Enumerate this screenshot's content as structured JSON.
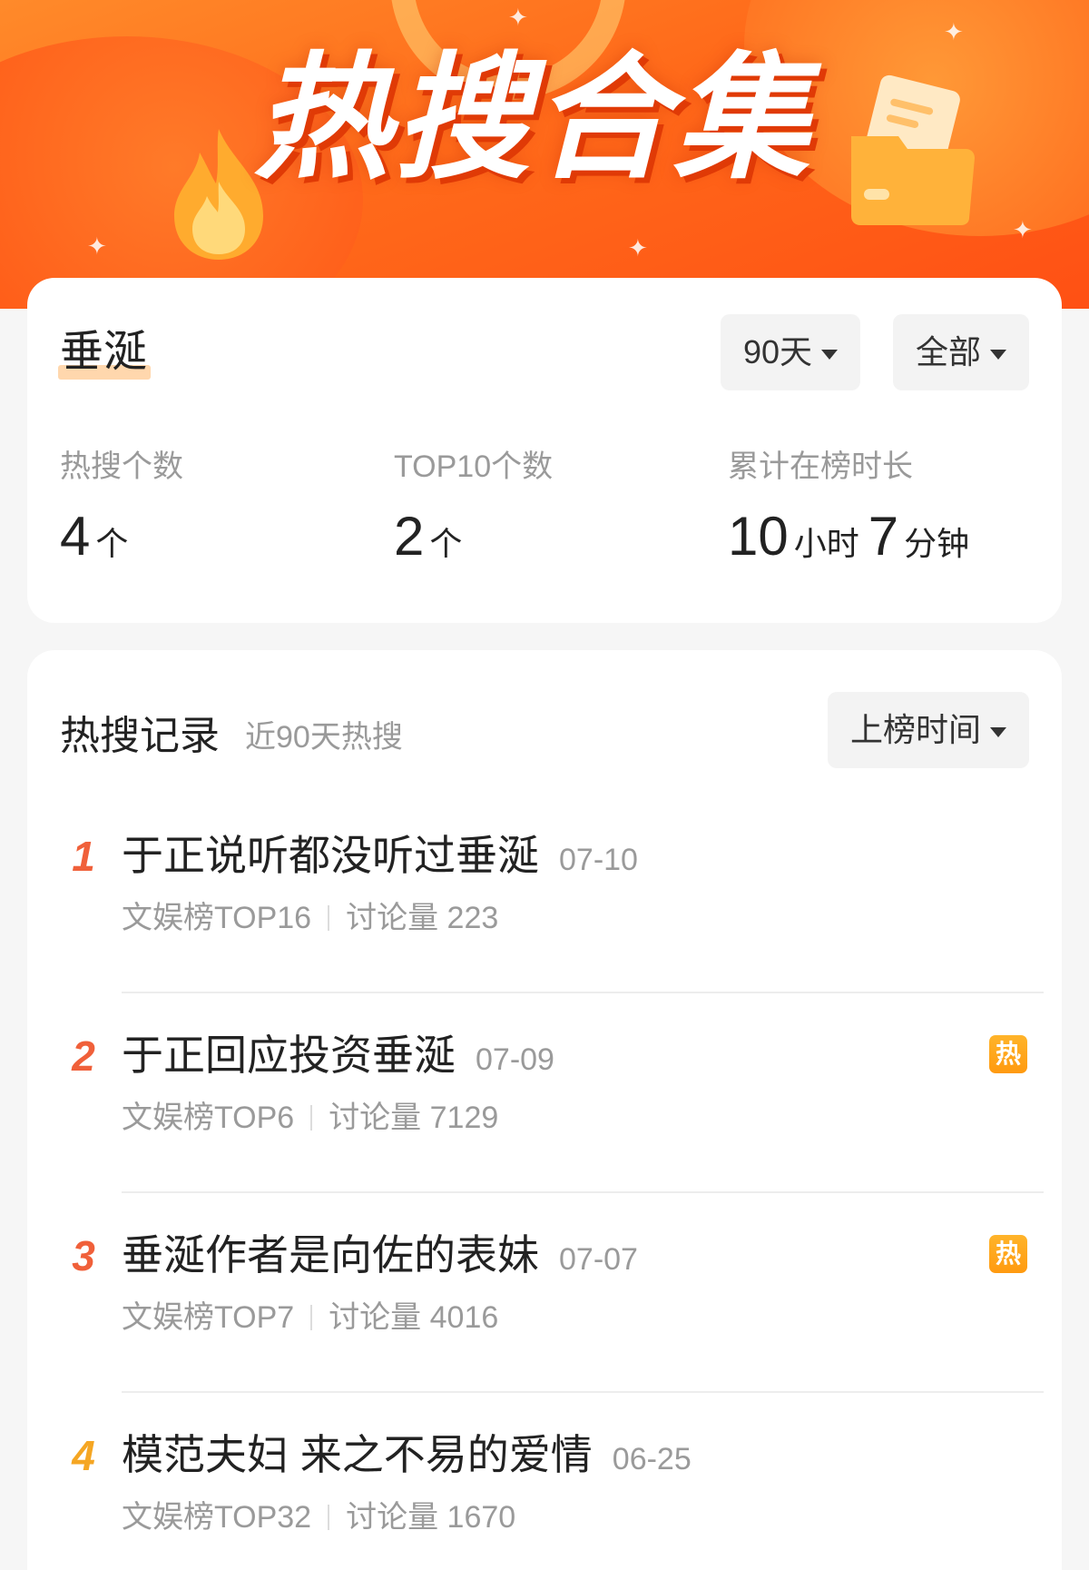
{
  "banner": {
    "title": "热搜合集"
  },
  "summary": {
    "keyword": "垂涎",
    "filters": {
      "days": "90天",
      "scope": "全部"
    },
    "stats": [
      {
        "label": "热搜个数",
        "value": "4",
        "unit": "个"
      },
      {
        "label": "TOP10个数",
        "value": "2",
        "unit": "个"
      },
      {
        "label": "累计在榜时长",
        "hours": "10",
        "hours_unit": "小时",
        "minutes": "7",
        "minutes_unit": "分钟"
      }
    ]
  },
  "records": {
    "title": "热搜记录",
    "subtitle": "近90天热搜",
    "sort": "上榜时间",
    "items": [
      {
        "rank": "1",
        "rank_color": "#f0603a",
        "topic": "于正说听都没听过垂涎",
        "date": "07-10",
        "board": "文娱榜TOP16",
        "discussion": "讨论量 223",
        "hot": ""
      },
      {
        "rank": "2",
        "rank_color": "#f0603a",
        "topic": "于正回应投资垂涎",
        "date": "07-09",
        "board": "文娱榜TOP6",
        "discussion": "讨论量 7129",
        "hot": "热"
      },
      {
        "rank": "3",
        "rank_color": "#f0603a",
        "topic": "垂涎作者是向佐的表妹",
        "date": "07-07",
        "board": "文娱榜TOP7",
        "discussion": "讨论量 4016",
        "hot": "热"
      },
      {
        "rank": "4",
        "rank_color": "#f5a623",
        "topic": "模范夫妇 来之不易的爱情",
        "date": "06-25",
        "board": "文娱榜TOP32",
        "discussion": "讨论量 1670",
        "hot": ""
      }
    ]
  },
  "colors": {
    "accent": "#ff6a1a",
    "hot_badge": "#ffa51c"
  }
}
